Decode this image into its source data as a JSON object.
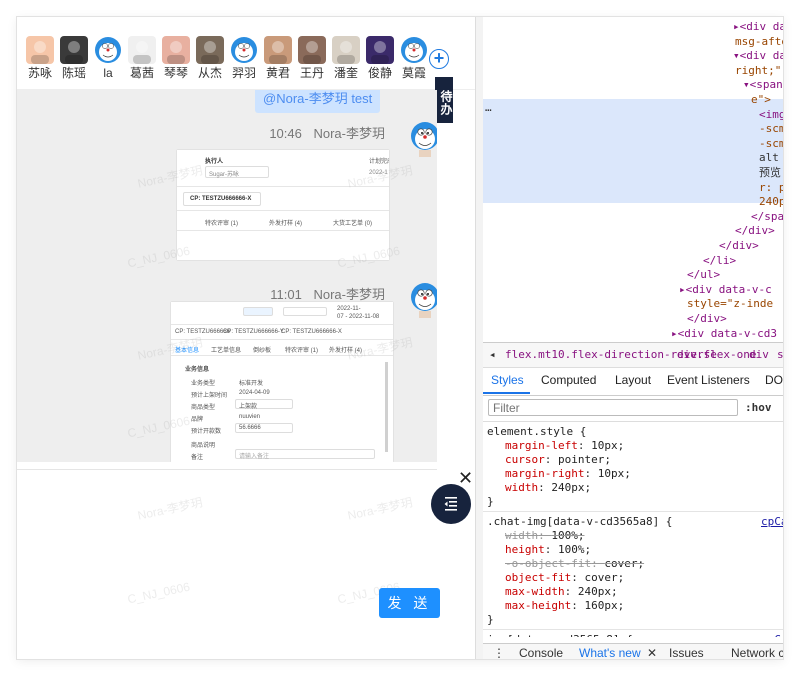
{
  "chat": {
    "members": [
      {
        "name": "苏咏",
        "avatar": "a1"
      },
      {
        "name": "陈瑶",
        "avatar": "a2"
      },
      {
        "name": "la",
        "avatar": "doraemon"
      },
      {
        "name": "葛茜",
        "avatar": "a4"
      },
      {
        "name": "琴琴",
        "avatar": "a5"
      },
      {
        "name": "从杰",
        "avatar": "a6"
      },
      {
        "name": "羿羽",
        "avatar": "doraemon"
      },
      {
        "name": "黄君",
        "avatar": "a8"
      },
      {
        "name": "王丹",
        "avatar": "a9"
      },
      {
        "name": "潘奎",
        "avatar": "a10"
      },
      {
        "name": "俊静",
        "avatar": "a11"
      },
      {
        "name": "莫霞",
        "avatar": "doraemon"
      }
    ],
    "add_member_icon": "plus-circle-icon",
    "todo_label": "待办",
    "top_bubble_text": "@Nora-李梦玥  test",
    "messages": [
      {
        "time": "10:46",
        "sender": "Nora-李梦玥"
      },
      {
        "time": "11:01",
        "sender": "Nora-李梦玥"
      }
    ],
    "shot1": {
      "executor_label": "执行人",
      "plan_label": "计划完成",
      "executor_value": "Sugar-苏咏",
      "date_value": "2022-1",
      "cp_label": "CP: TESTZU666666-X",
      "tabs": [
        "特农评审 (1)",
        "外发打样 (4)",
        "大货工艺单 (0)"
      ]
    },
    "shot2": {
      "time_text": "2022-11-",
      "time_text2": "07 - 2022-11-08",
      "tabs": [
        "CP: TESTZU666666",
        "CP: TESTZU666666-Y",
        "CP: TESTZU666666-X"
      ],
      "sub_tabs": [
        "基本信息",
        "工艺单信息",
        "倒纱板",
        "特农评审 (1)",
        "外发打样 (4)"
      ],
      "section": "业务信息",
      "rows": [
        {
          "label": "业务类型",
          "value": "标准开发"
        },
        {
          "label": "预计上架时间",
          "value": "2024-04-09"
        },
        {
          "label": "商品类型",
          "value": "上架款"
        },
        {
          "label": "品牌",
          "value": "nuuvien"
        },
        {
          "label": "预计开款数",
          "value": "56.6666"
        },
        {
          "label": "商品说明",
          "value": ""
        },
        {
          "label": "备注",
          "value": "请输入备注"
        }
      ]
    },
    "watermarks": [
      "Nora-李梦玥",
      "C_NJ_0606"
    ],
    "close_icon": "close-icon",
    "fab_icon": "menu-fold-icon",
    "send_label": "发 送"
  },
  "devtools": {
    "dom_lines": [
      {
        "indent": 250,
        "text": "▸<div da",
        "kind": "tag"
      },
      {
        "indent": 252,
        "text": "msg-afte",
        "kind": "attr"
      },
      {
        "indent": 250,
        "text": "▾<div da",
        "kind": "tag"
      },
      {
        "indent": 252,
        "text": "right;\"",
        "kind": "attr"
      },
      {
        "indent": 260,
        "text": "▾<span",
        "kind": "tag"
      },
      {
        "indent": 268,
        "text": "e\">",
        "kind": "attr"
      },
      {
        "indent": 276,
        "text": "<img",
        "kind": "tag"
      },
      {
        "indent": 276,
        "text": "-scm",
        "kind": "attr"
      },
      {
        "indent": 276,
        "text": "-scm",
        "kind": "attr"
      },
      {
        "indent": 276,
        "text": "alt",
        "kind": "plain"
      },
      {
        "indent": 276,
        "text": "预览'",
        "kind": "plain"
      },
      {
        "indent": 276,
        "text": "r: p",
        "kind": "attr"
      },
      {
        "indent": 276,
        "text": "240p",
        "kind": "attr"
      },
      {
        "indent": 268,
        "text": "</span",
        "kind": "tag"
      },
      {
        "indent": 252,
        "text": "</div>",
        "kind": "tag"
      },
      {
        "indent": 236,
        "text": "</div>",
        "kind": "tag"
      },
      {
        "indent": 220,
        "text": "</li>",
        "kind": "tag"
      },
      {
        "indent": 204,
        "text": "</ul>",
        "kind": "tag"
      },
      {
        "indent": 196,
        "text": "▸<div data-v-c",
        "kind": "tag"
      },
      {
        "indent": 204,
        "text": "style=\"z-inde",
        "kind": "attr"
      },
      {
        "indent": 204,
        "text": "</div>",
        "kind": "tag"
      },
      {
        "indent": 188,
        "text": "▸<div data-v-cd3",
        "kind": "tag"
      },
      {
        "indent": 196,
        "text": "⋯ </div>",
        "kind": "tag"
      }
    ],
    "ellipsis": "…",
    "breadcrumbs": [
      "◂",
      "flex.mt10.flex-direction-reverse",
      "div.flex-one",
      "div",
      "s"
    ],
    "tabs": [
      "Styles",
      "Computed",
      "Layout",
      "Event Listeners",
      "DO"
    ],
    "filter_placeholder": "Filter",
    "hov_label": ":hov",
    "rules": [
      {
        "selector": "element.style {",
        "source": "",
        "decls": [
          {
            "prop": "margin-left",
            "val": "10px;",
            "strike": false
          },
          {
            "prop": "cursor",
            "val": "pointer;",
            "strike": false
          },
          {
            "prop": "margin-right",
            "val": "10px;",
            "strike": false
          },
          {
            "prop": "width",
            "val": "240px;",
            "strike": false
          }
        ]
      },
      {
        "selector": ".chat-img[data-v-cd3565a8] {",
        "source": "cpCa",
        "decls": [
          {
            "prop": "width",
            "val": "100%;",
            "strike": true
          },
          {
            "prop": "height",
            "val": "100%;",
            "strike": false
          },
          {
            "prop": "-o-object-fit",
            "val": "cover;",
            "strike": true
          },
          {
            "prop": "object-fit",
            "val": "cover;",
            "strike": false
          },
          {
            "prop": "max-width",
            "val": "240px;",
            "strike": false
          },
          {
            "prop": "max-height",
            "val": "160px;",
            "strike": false
          }
        ]
      },
      {
        "selector": "img[data-v-cd3565a8] {",
        "source": "cpCa",
        "decls": []
      }
    ],
    "drawer_tabs": [
      "⋮",
      "Console",
      "What's new",
      "✕",
      "Issues",
      "Network c"
    ]
  },
  "colors": {
    "accent": "#1e90ff",
    "todo_bg": "#17233d",
    "highlight": "#dbe7fb",
    "bubble_bg": "#cde3ff"
  }
}
